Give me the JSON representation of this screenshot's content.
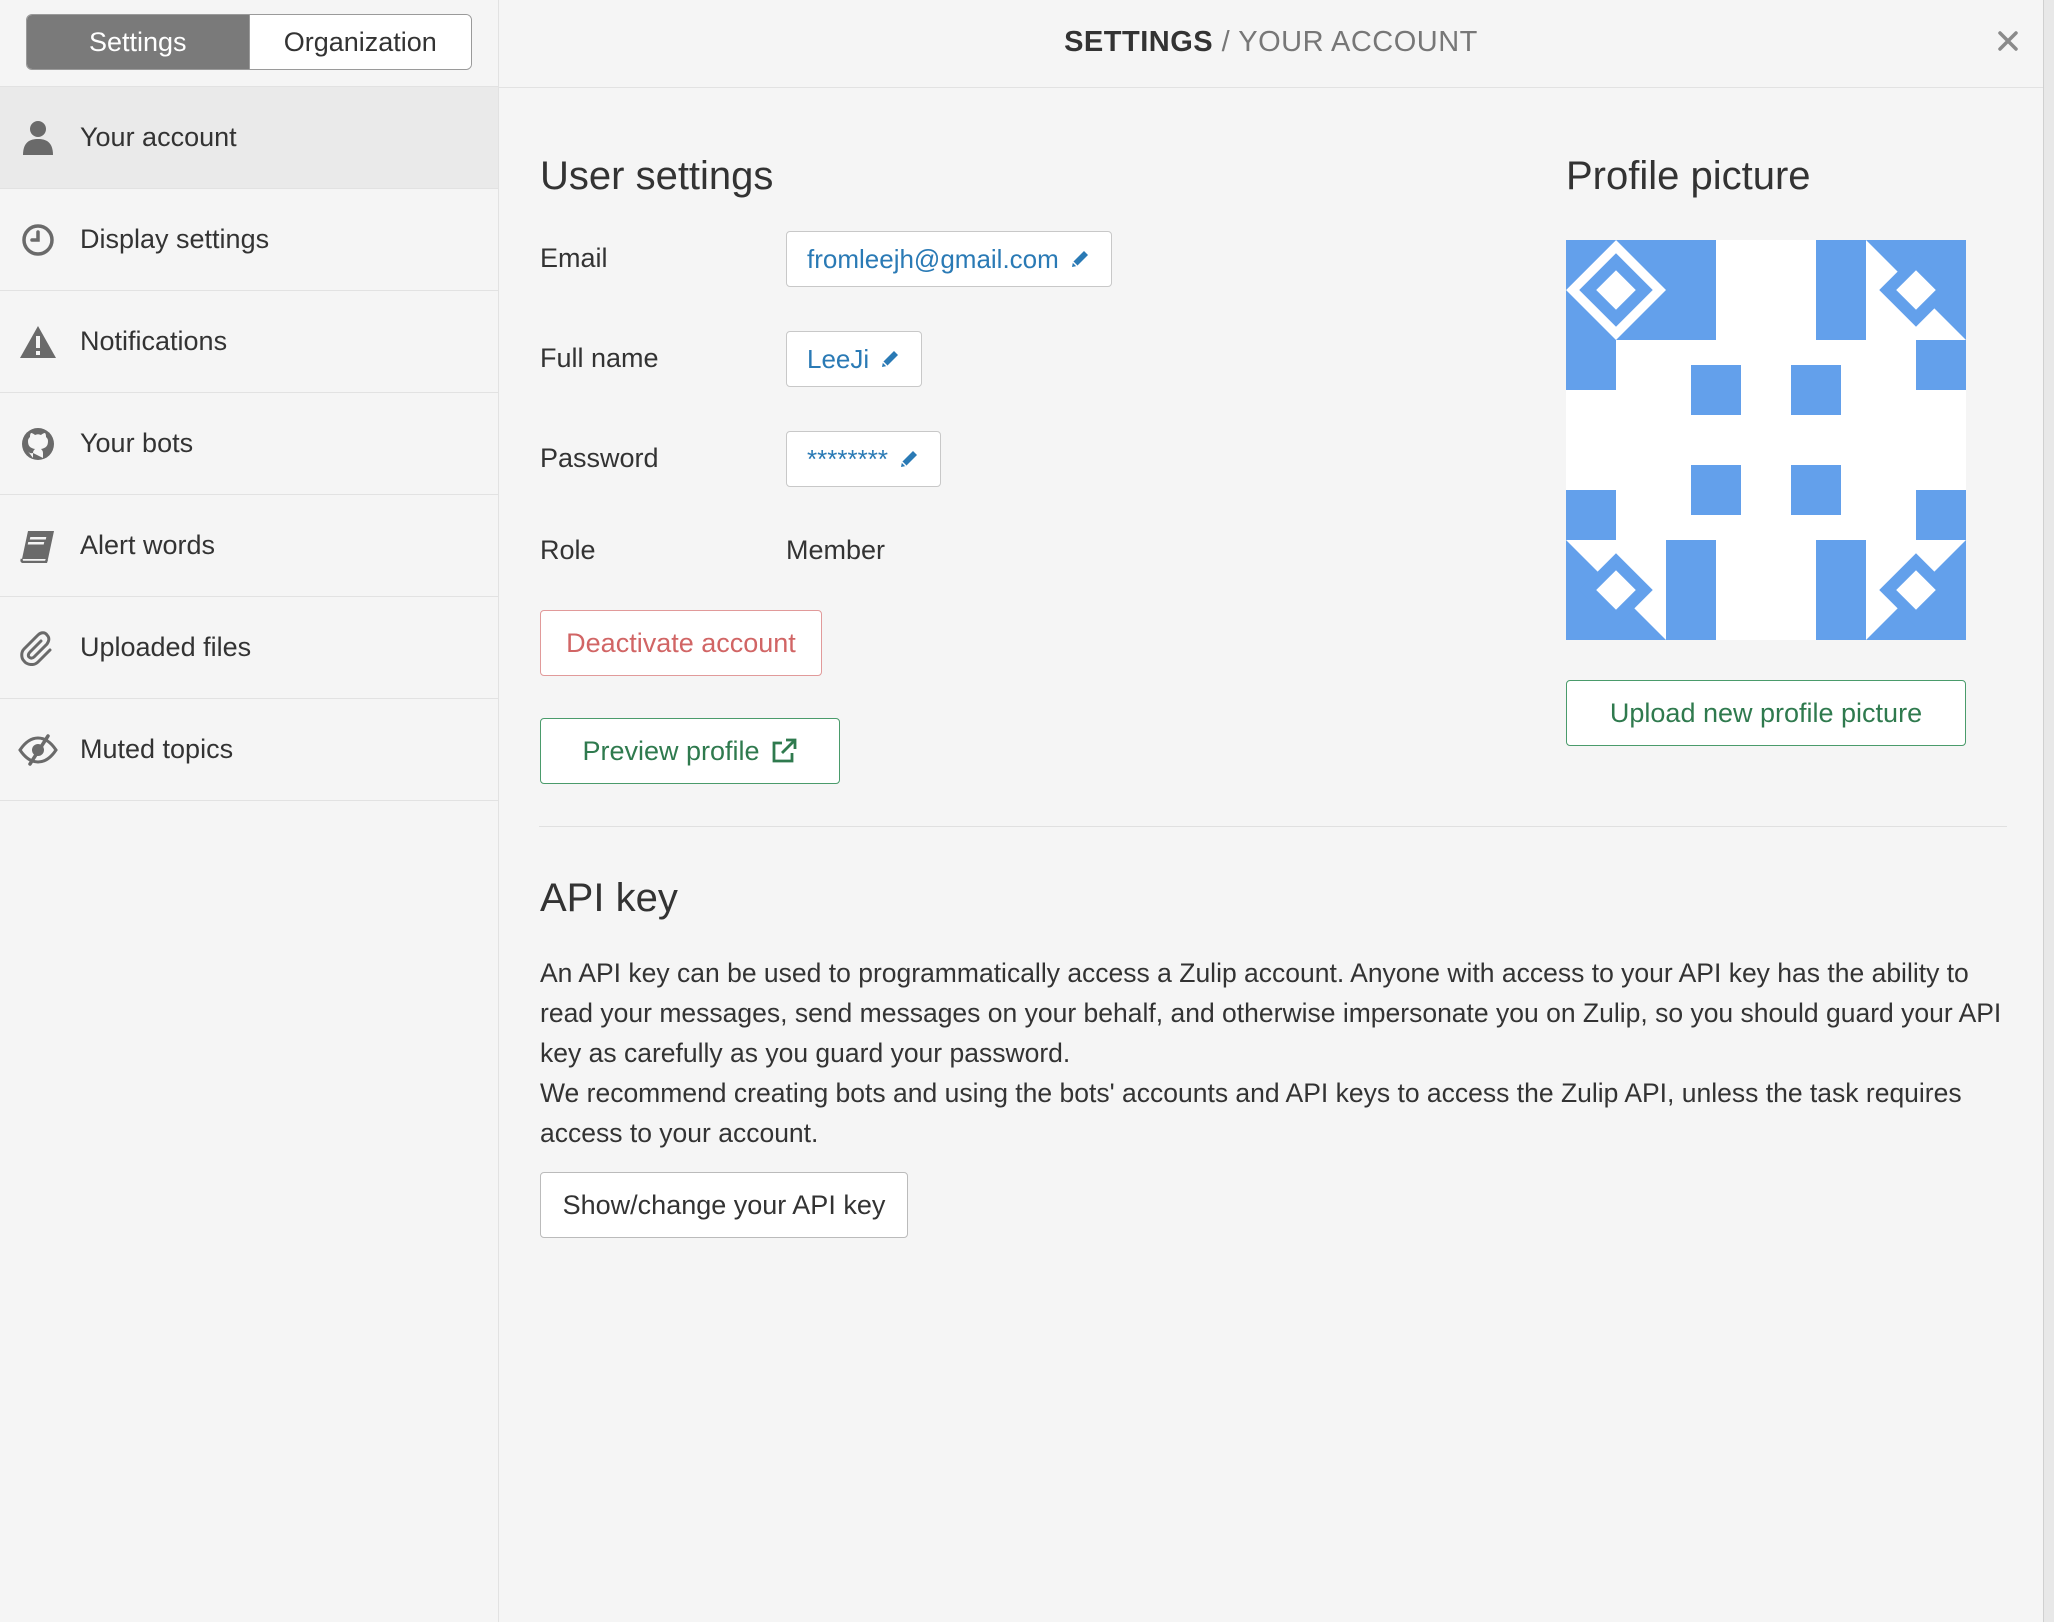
{
  "sidebar": {
    "tabs": [
      {
        "label": "Settings",
        "active": true
      },
      {
        "label": "Organization",
        "active": false
      }
    ],
    "items": [
      {
        "label": "Your account",
        "icon": "user-icon",
        "active": true
      },
      {
        "label": "Display settings",
        "icon": "clock-icon",
        "active": false
      },
      {
        "label": "Notifications",
        "icon": "warning-icon",
        "active": false
      },
      {
        "label": "Your bots",
        "icon": "github-icon",
        "active": false
      },
      {
        "label": "Alert words",
        "icon": "book-icon",
        "active": false
      },
      {
        "label": "Uploaded files",
        "icon": "paperclip-icon",
        "active": false
      },
      {
        "label": "Muted topics",
        "icon": "eye-slash-icon",
        "active": false
      }
    ]
  },
  "header": {
    "title_strong": "SETTINGS",
    "separator": "/",
    "title_sub": "YOUR ACCOUNT",
    "close_icon": "close-icon"
  },
  "user_settings": {
    "heading": "User settings",
    "email_label": "Email",
    "email_value": "fromleejh@gmail.com",
    "full_name_label": "Full name",
    "full_name_value": "LeeJi",
    "password_label": "Password",
    "password_value": "********",
    "role_label": "Role",
    "role_value": "Member",
    "deactivate_label": "Deactivate account",
    "preview_label": "Preview profile"
  },
  "profile_picture": {
    "heading": "Profile picture",
    "upload_label": "Upload new profile picture",
    "avatar_color": "#63a0eb"
  },
  "api_key": {
    "heading": "API key",
    "paragraph1": "An API key can be used to programmatically access a Zulip account. Anyone with access to your API key has the ability to read your messages, send messages on your behalf, and otherwise impersonate you on Zulip, so you should guard your API key as carefully as you guard your password.",
    "paragraph2": "We recommend creating bots and using the bots' accounts and API keys to access the Zulip API, unless the task requires access to your account.",
    "button_label": "Show/change your API key"
  },
  "colors": {
    "link": "#2a7ab5",
    "danger": "#d16565",
    "success": "#2f7a4e",
    "active_tab": "#7a7a7a"
  }
}
